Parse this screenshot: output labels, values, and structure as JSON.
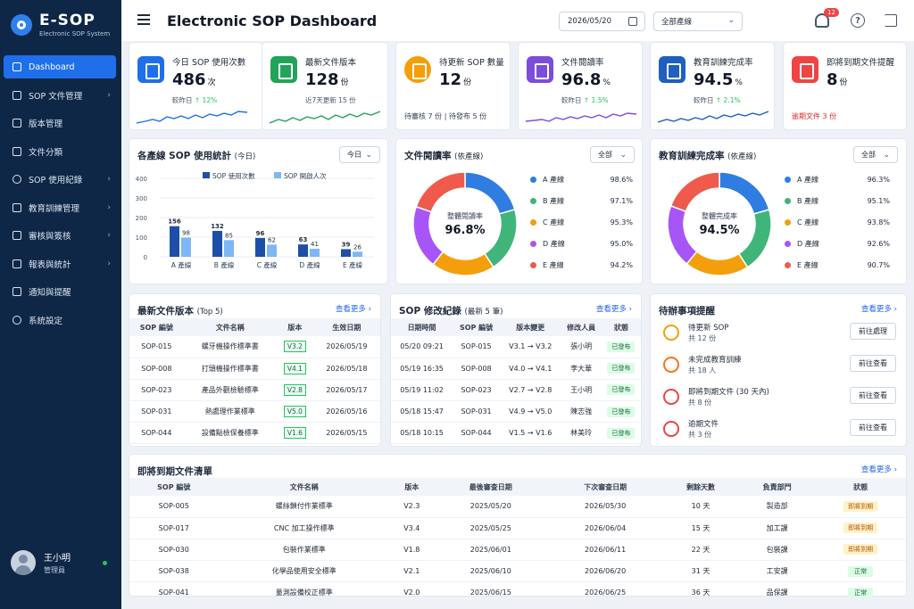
{
  "sidebar": {
    "logo_title": "E-SOP",
    "logo_subtitle": "Electronic SOP System",
    "items": [
      {
        "label": "Dashboard"
      },
      {
        "label": "SOP 文件管理"
      },
      {
        "label": "版本管理"
      },
      {
        "label": "文件分類"
      },
      {
        "label": "SOP 使用紀錄"
      },
      {
        "label": "教育訓練管理"
      },
      {
        "label": "審核與簽核"
      },
      {
        "label": "報表與統計"
      },
      {
        "label": "通知與提醒"
      },
      {
        "label": "系統設定"
      }
    ],
    "user_name": "王小明",
    "user_role": "管理員"
  },
  "header": {
    "title": "Electronic SOP Dashboard",
    "date": "2026/05/20",
    "line_select": "全部產線",
    "notification_count": "12"
  },
  "kpis": [
    {
      "title": "今日 SOP 使用次數",
      "value": "486",
      "unit": "次",
      "sub": "較昨日",
      "trend": "↑ 12%",
      "color": "#1f6feb"
    },
    {
      "title": "最新文件版本",
      "value": "128",
      "unit": "份",
      "sub": "近7天更新 15 份",
      "color": "#22a35a"
    },
    {
      "title": "待更新 SOP 數量",
      "value": "12",
      "unit": "份",
      "note": "待審核 7 份 | 待發布 5 份",
      "color": "#f59e0b"
    },
    {
      "title": "文件閱讀率",
      "value": "96.8",
      "unit": "%",
      "sub": "較昨日",
      "trend": "↑ 1.5%",
      "color": "#7c4ddb"
    },
    {
      "title": "教育訓練完成率",
      "value": "94.5",
      "unit": "%",
      "sub": "較昨日",
      "trend": "↑ 2.1%",
      "color": "#1f5fbf"
    },
    {
      "title": "即將到期文件提醒",
      "value": "8",
      "unit": "份",
      "note": "逾期文件 3 份",
      "color": "#ef4444"
    }
  ],
  "usage_chart": {
    "title": "各產線 SOP 使用統計",
    "title_suffix": "(今日)",
    "range_select": "今日",
    "chart_data": {
      "type": "bar",
      "categories": [
        "A 產線",
        "B 產線",
        "C 產線",
        "D 產線",
        "E 產線"
      ],
      "series": [
        {
          "name": "SOP 使用次數",
          "values": [
            156,
            132,
            96,
            63,
            39
          ],
          "color": "#1e4fa8"
        },
        {
          "name": "SOP 開啟人次",
          "values": [
            98,
            85,
            62,
            41,
            26
          ],
          "color": "#7db7f5"
        }
      ],
      "yticks": [
        0,
        100,
        200,
        300,
        400
      ],
      "ylim": [
        0,
        400
      ],
      "legend": "top"
    }
  },
  "read_rate": {
    "title": "文件閱讀率",
    "title_suffix": "(依產線)",
    "select": "全部",
    "center_label": "整體閱讀率",
    "center_value": "96.8%",
    "chart_data": {
      "type": "pie",
      "labels": [
        "A 產線",
        "B 產線",
        "C 產線",
        "D 產線",
        "E 產線"
      ],
      "values": [
        98.6,
        97.1,
        95.3,
        95.0,
        94.2
      ],
      "display": [
        "98.6%",
        "97.1%",
        "95.3%",
        "95.0%",
        "94.2%"
      ],
      "colors": [
        "#2f7de1",
        "#3fb57a",
        "#f59e0b",
        "#a855f7",
        "#ef5a4c"
      ]
    }
  },
  "training_rate": {
    "title": "教育訓練完成率",
    "title_suffix": "(依產線)",
    "select": "全部",
    "center_label": "整體完成率",
    "center_value": "94.5%",
    "chart_data": {
      "type": "pie",
      "labels": [
        "A 產線",
        "B 產線",
        "C 產線",
        "D 產線",
        "E 產線"
      ],
      "values": [
        96.3,
        95.1,
        93.8,
        92.6,
        90.7
      ],
      "display": [
        "96.3%",
        "95.1%",
        "93.8%",
        "92.6%",
        "90.7%"
      ],
      "colors": [
        "#2f7de1",
        "#3fb57a",
        "#f59e0b",
        "#a855f7",
        "#ef5a4c"
      ]
    }
  },
  "latest_versions": {
    "title": "最新文件版本",
    "title_suffix": "(Top 5)",
    "more": "查看更多",
    "columns": [
      "SOP 編號",
      "文件名稱",
      "版本",
      "生效日期"
    ],
    "rows": [
      [
        "SOP-015",
        "螺牙機操作標準書",
        "V3.2",
        "2026/05/19"
      ],
      [
        "SOP-008",
        "打頭機操作標準書",
        "V4.1",
        "2026/05/18"
      ],
      [
        "SOP-023",
        "產品外觀檢驗標準",
        "V2.8",
        "2026/05/17"
      ],
      [
        "SOP-031",
        "熱處理作業標準",
        "V5.0",
        "2026/05/16"
      ],
      [
        "SOP-044",
        "設備點檢保養標準",
        "V1.6",
        "2026/05/15"
      ]
    ]
  },
  "changes": {
    "title": "SOP 修改紀錄",
    "title_suffix": "(最新 5 筆)",
    "more": "查看更多",
    "columns": [
      "日期時間",
      "SOP 編號",
      "版本變更",
      "修改人員",
      "狀態"
    ],
    "rows": [
      [
        "05/20 09:21",
        "SOP-015",
        "V3.1 → V3.2",
        "張小明",
        "已發布"
      ],
      [
        "05/19 16:35",
        "SOP-008",
        "V4.0 → V4.1",
        "李大華",
        "已發布"
      ],
      [
        "05/19 11:02",
        "SOP-023",
        "V2.7 → V2.8",
        "王小明",
        "已發布"
      ],
      [
        "05/18 15:47",
        "SOP-031",
        "V4.9 → V5.0",
        "陳志強",
        "已發布"
      ],
      [
        "05/18 10:15",
        "SOP-044",
        "V1.5 → V1.6",
        "林美玲",
        "已發布"
      ]
    ]
  },
  "todos": {
    "title": "待辦事項提醒",
    "more": "查看更多",
    "items": [
      {
        "title": "待更新 SOP",
        "sub": "共 12 份",
        "button": "前往處理",
        "color": "#f59e0b"
      },
      {
        "title": "未完成教育訓練",
        "sub": "共 18 人",
        "button": "前往查看",
        "color": "#f97316"
      },
      {
        "title": "即將到期文件 (30 天內)",
        "sub": "共 8 份",
        "button": "前往查看",
        "color": "#ef4444"
      },
      {
        "title": "逾期文件",
        "sub": "共 3 份",
        "button": "前往查看",
        "color": "#ef4444"
      }
    ]
  },
  "expiring": {
    "title": "即將到期文件清單",
    "more": "查看更多",
    "columns": [
      "SOP 編號",
      "文件名稱",
      "版本",
      "最後審查日期",
      "下次審查日期",
      "剩餘天數",
      "負責部門",
      "狀態"
    ],
    "rows": [
      [
        "SOP-005",
        "螺絲鎖付作業標準",
        "V2.3",
        "2025/05/20",
        "2026/05/30",
        "10 天",
        "製造部",
        "即將到期"
      ],
      [
        "SOP-017",
        "CNC 加工操作標準",
        "V3.4",
        "2025/05/25",
        "2026/06/04",
        "15 天",
        "加工課",
        "即將到期"
      ],
      [
        "SOP-030",
        "包裝作業標準",
        "V1.8",
        "2025/06/01",
        "2026/06/11",
        "22 天",
        "包裝課",
        "即將到期"
      ],
      [
        "SOP-038",
        "化學品使用安全標準",
        "V2.1",
        "2025/06/10",
        "2026/06/20",
        "31 天",
        "工安課",
        "正常"
      ],
      [
        "SOP-041",
        "量測設備校正標準",
        "V2.0",
        "2025/06/15",
        "2026/06/25",
        "36 天",
        "品保課",
        "正常"
      ]
    ]
  }
}
